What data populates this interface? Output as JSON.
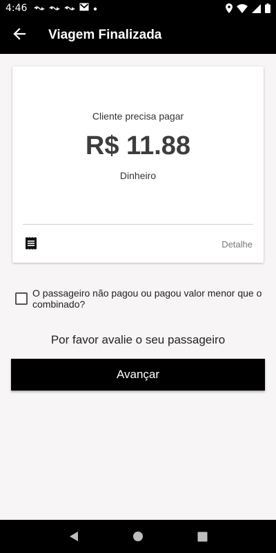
{
  "status_bar": {
    "time": "4:46",
    "notification_icons": [
      "carrier-icon",
      "carrier-icon",
      "carrier-icon",
      "gmail-icon",
      "dot-icon"
    ],
    "right_icons": [
      "location-icon",
      "wifi-icon",
      "signal-icon",
      "battery-icon"
    ]
  },
  "app_bar": {
    "title": "Viagem Finalizada",
    "back_icon": "arrow-left-icon"
  },
  "payment_card": {
    "caption": "Cliente precisa pagar",
    "amount": "R$ 11.88",
    "method": "Dinheiro",
    "detail_label": "Detalhe",
    "receipt_icon": "receipt-icon"
  },
  "unpaid_checkbox": {
    "label": "O passageiro não pagou ou pagou valor menor que o combinado?",
    "checked": false
  },
  "rating_prompt": "Por favor avalie o seu passageiro",
  "advance_button": "Avançar",
  "nav_bar": {
    "icons": [
      "back-triangle-icon",
      "home-circle-icon",
      "recents-square-icon"
    ]
  },
  "colors": {
    "app_bar": "#000000",
    "background": "#f7f5f6",
    "button": "#000000",
    "amount_text": "#3d3d3d"
  }
}
